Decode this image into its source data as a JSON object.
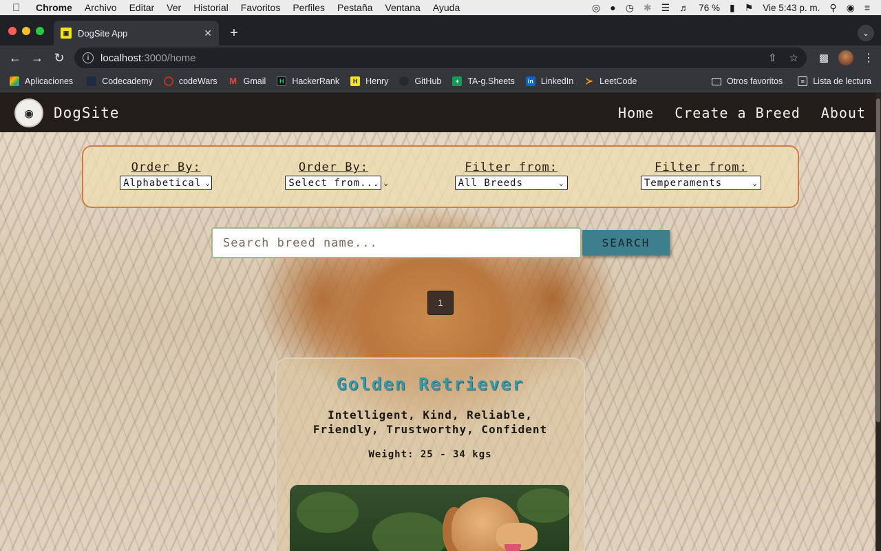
{
  "menubar": {
    "app": "Chrome",
    "items": [
      "Archivo",
      "Editar",
      "Ver",
      "Historial",
      "Favoritos",
      "Perfiles",
      "Pestaña",
      "Ventana",
      "Ayuda"
    ],
    "battery": "76 %",
    "clock": "Vie 5:43 p. m."
  },
  "browser": {
    "tab_title": "DogSite App",
    "url_host": "localhost",
    "url_path": ":3000/home",
    "bookmarks": [
      "Aplicaciones",
      "Codecademy",
      "codeWars",
      "Gmail",
      "HackerRank",
      "Henry",
      "GitHub",
      "TA-g.Sheets",
      "LinkedIn",
      "LeetCode"
    ],
    "bookmarks_right": [
      "Otros favoritos",
      "Lista de lectura"
    ]
  },
  "site": {
    "brand": "DogSite",
    "nav": [
      "Home",
      "Create a Breed",
      "About"
    ],
    "filters": [
      {
        "label": "Order By:",
        "value": "Alphabetical"
      },
      {
        "label": "Order By:",
        "value": "Select from..."
      },
      {
        "label": "Filter from:",
        "value": "All Breeds"
      },
      {
        "label": "Filter from:",
        "value": "Temperaments"
      }
    ],
    "search_placeholder": "Search breed name...",
    "search_button": "SEARCH",
    "page_number": "1",
    "card": {
      "name": "Golden Retriever",
      "temperaments": "Intelligent, Kind, Reliable, Friendly, Trustworthy, Confident",
      "weight": "Weight: 25 - 34 kgs"
    }
  }
}
